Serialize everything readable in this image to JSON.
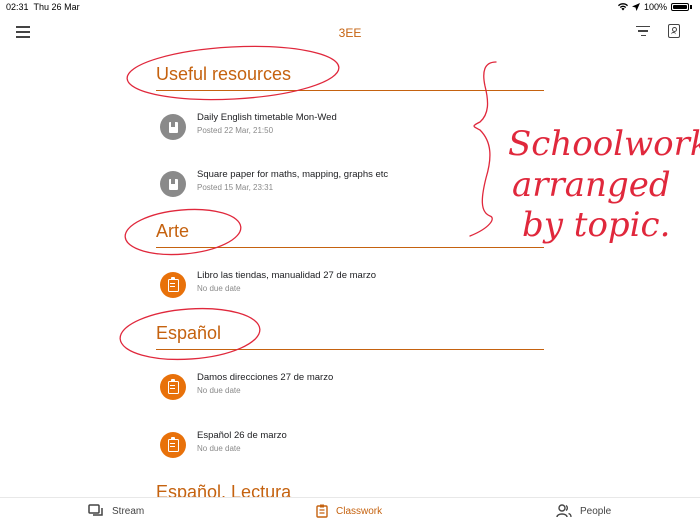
{
  "status": {
    "time": "02:31",
    "date": "Thu 26 Mar",
    "battery": "100%"
  },
  "appbar": {
    "title": "3EE"
  },
  "topics": [
    {
      "name": "Useful resources",
      "items": [
        {
          "title": "Daily English timetable Mon-Wed",
          "subtitle": "Posted 22 Mar, 21:50",
          "icon": "material-icon"
        },
        {
          "title": "Square paper for maths, mapping, graphs etc",
          "subtitle": "Posted 15 Mar, 23:31",
          "icon": "material-icon"
        }
      ]
    },
    {
      "name": "Arte",
      "items": [
        {
          "title": "Libro las tiendas, manualidad 27 de marzo",
          "subtitle": "No due date",
          "icon": "assignment-icon"
        }
      ]
    },
    {
      "name": "Español",
      "items": [
        {
          "title": "Damos direcciones 27 de marzo",
          "subtitle": "No due date",
          "icon": "assignment-icon"
        },
        {
          "title": "Español 26 de marzo",
          "subtitle": "No due date",
          "icon": "assignment-icon"
        }
      ]
    },
    {
      "name": "Español, Lectura",
      "items": []
    }
  ],
  "annotation": {
    "lines": [
      "Schoolwork",
      "arranged",
      "by topic."
    ]
  },
  "nav": {
    "stream": "Stream",
    "classwork": "Classwork",
    "people": "People"
  },
  "colors": {
    "accent": "#c5620f",
    "assignment": "#e8710a",
    "ink": "#e0283c",
    "material": "#8a8a8a"
  }
}
